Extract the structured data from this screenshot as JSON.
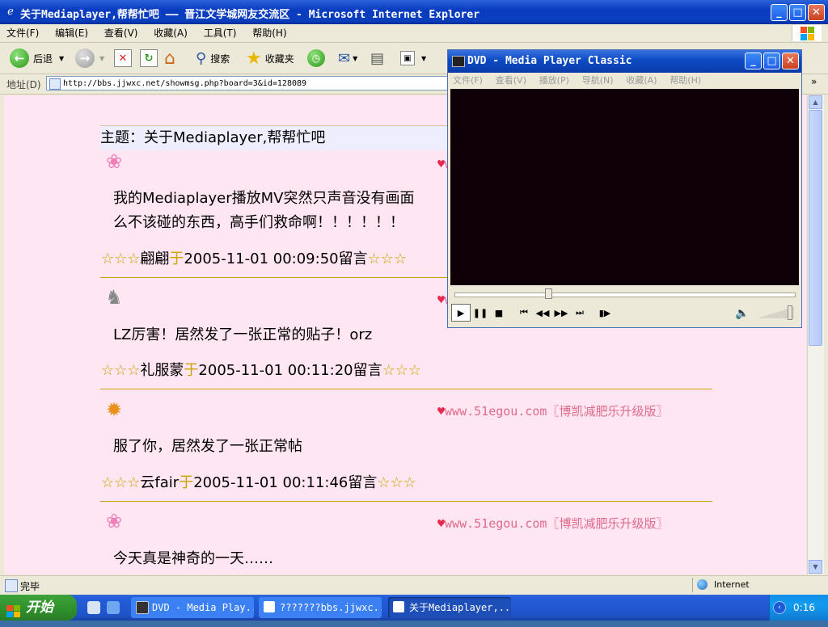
{
  "ie": {
    "title": "关于Mediaplayer,帮帮忙吧 —— 晋江文学城网友交流区 - Microsoft Internet Explorer",
    "menu": [
      "文件(F)",
      "编辑(E)",
      "查看(V)",
      "收藏(A)",
      "工具(T)",
      "帮助(H)"
    ],
    "toolbar": {
      "back": "后退",
      "search": "搜索",
      "favorites": "收藏夹"
    },
    "address_label": "地址(D)",
    "address": "http://bbs.jjwxc.net/showmsg.php?board=3&id=128089",
    "status": "完毕",
    "zone": "Internet"
  },
  "forum": {
    "topic": "主题：关于Mediaplayer,帮帮忙吧",
    "ad": "www.51egou.com〖博凯减肥乐升级版〗",
    "posts": [
      {
        "avatar": "pink-monster",
        "lines": [
          "我的Mediaplayer播放MV突然只声音没有画面",
          "么不该碰的东西，高手们救命啊！！！！！！"
        ],
        "author": "翩翩",
        "yu": "于",
        "time": "2005-11-01 00:09:50",
        "suffix": "留言"
      },
      {
        "avatar": "rabbit",
        "lines": [
          "LZ厉害！居然发了一张正常的贴子！orz"
        ],
        "author": "礼服蒙",
        "yu": "于",
        "time": "2005-11-01 00:11:20",
        "suffix": "留言"
      },
      {
        "avatar": "garfield",
        "lines": [
          "服了你，居然发了一张正常帖"
        ],
        "author": "云fair",
        "yu": "于",
        "time": "2005-11-01 00:11:46",
        "suffix": "留言"
      },
      {
        "avatar": "pink-monster",
        "lines": [
          "今天真是神奇的一天……"
        ]
      }
    ],
    "stars": "☆☆☆"
  },
  "mpc": {
    "title": "DVD - Media Player Classic",
    "menu": [
      "文件(F)",
      "查看(V)",
      "播放(P)",
      "导航(N)",
      "收藏(A)",
      "帮助(H)"
    ],
    "seek_fraction": 0.27,
    "volume_fraction": 0.9
  },
  "taskbar": {
    "start": "开始",
    "tasks": [
      "DVD - Media Play...",
      "???????bbs.jjwxc...",
      "关于Mediaplayer,..."
    ],
    "clock": "0:16"
  }
}
